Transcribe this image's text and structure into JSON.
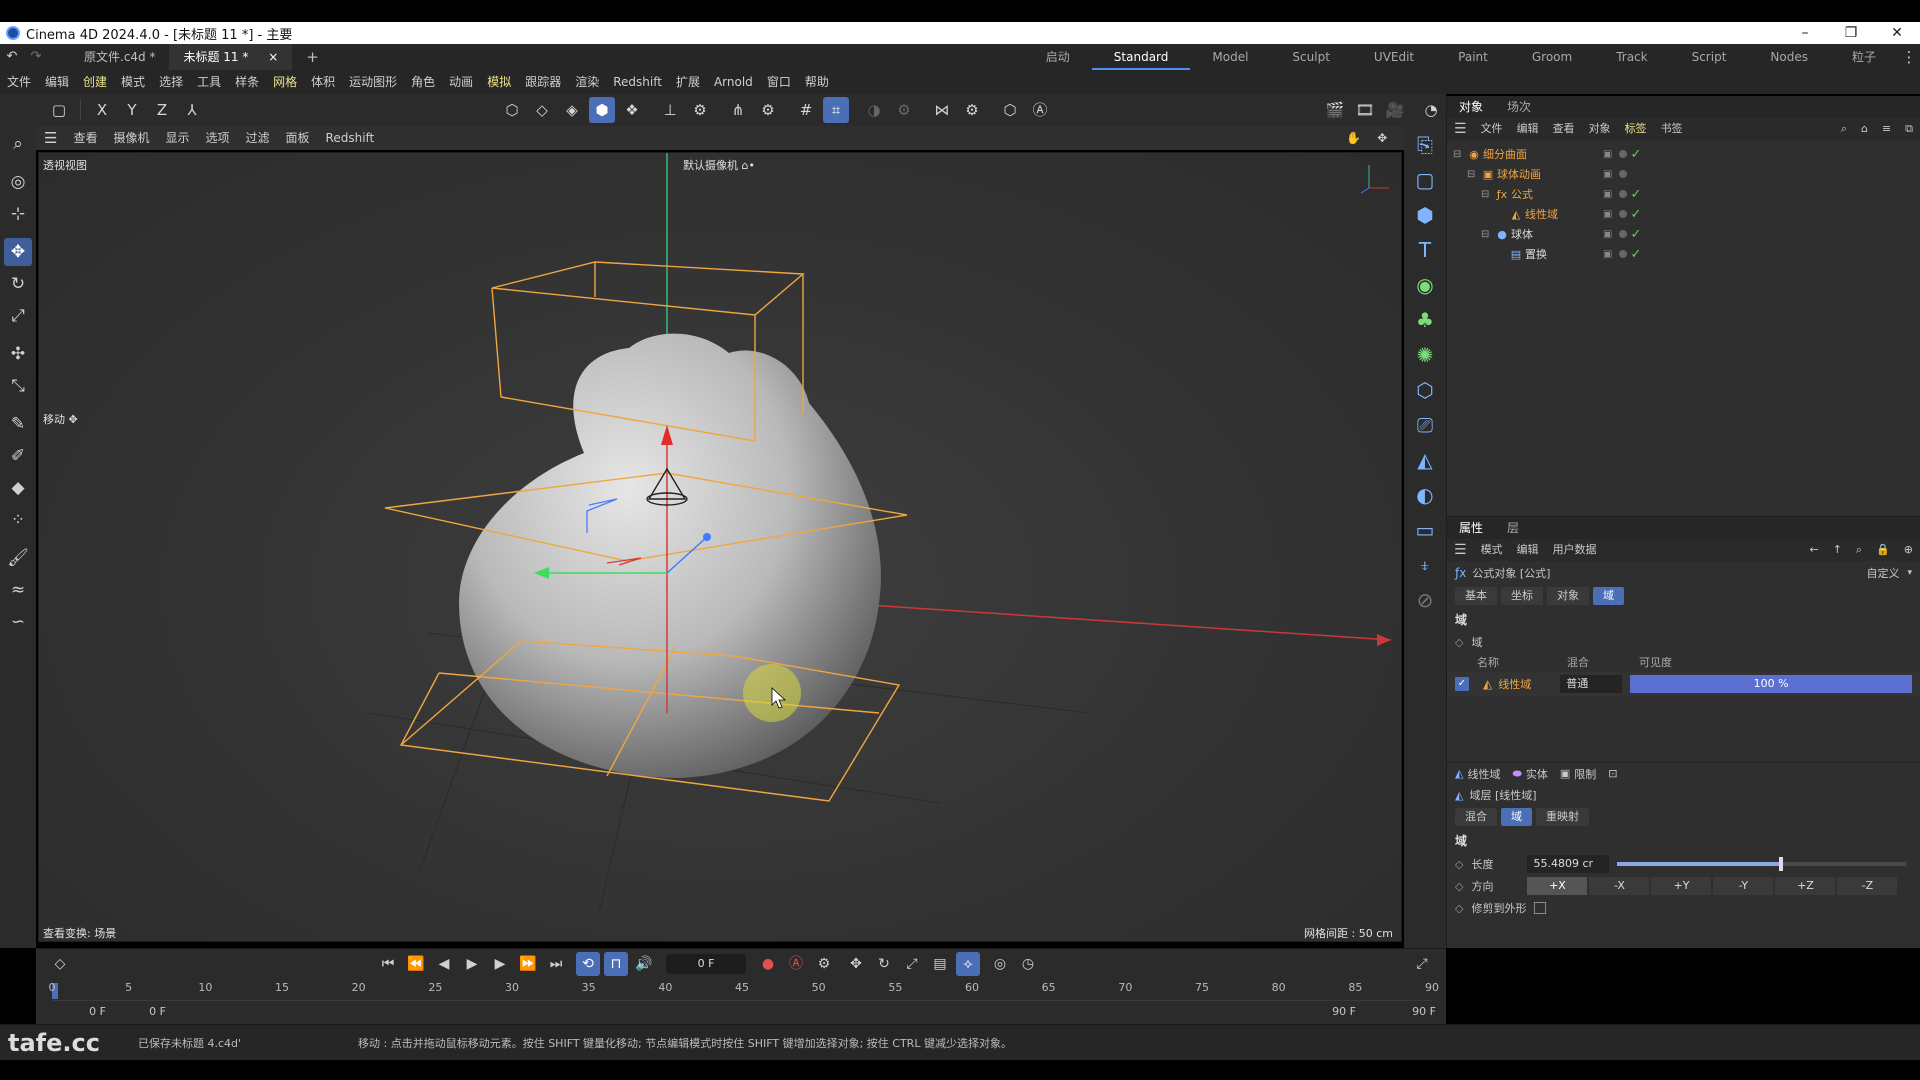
{
  "window": {
    "title": "Cinema 4D 2024.4.0 - [未标题 11 *] - 主要",
    "minimize": "–",
    "maximize": "❐",
    "close": "✕"
  },
  "doc_tabs": [
    {
      "label": "原文件.c4d *"
    },
    {
      "label": "未标题 11 *"
    }
  ],
  "doc_tab_close": "×",
  "doc_tab_add": "+",
  "layouts": [
    "启动",
    "Standard",
    "Model",
    "Sculpt",
    "UVEdit",
    "Paint",
    "Groom",
    "Track",
    "Script",
    "Nodes",
    "粒子"
  ],
  "menu": [
    "文件",
    "编辑",
    "创建",
    "模式",
    "选择",
    "工具",
    "样条",
    "网格",
    "体积",
    "运动图形",
    "角色",
    "动画",
    "模拟",
    "跟踪器",
    "渲染",
    "Redshift",
    "扩展",
    "Arnold",
    "窗口",
    "帮助"
  ],
  "toolbar_axes": [
    "X",
    "Y",
    "Z"
  ],
  "viewport_menu": [
    "查看",
    "摄像机",
    "显示",
    "选项",
    "过滤",
    "面板",
    "Redshift"
  ],
  "viewport": {
    "view_name": "透视视图",
    "camera": "默认摄像机 ⌂•",
    "move_label": "移动 ✥",
    "view_transform": "查看变换: 场景",
    "grid_spacing": "网格间距 : 50 cm"
  },
  "object_manager": {
    "tabs": [
      "对象",
      "场次"
    ],
    "menu": [
      "文件",
      "编辑",
      "查看",
      "对象",
      "标签",
      "书签"
    ],
    "tree": [
      {
        "name": "细分曲面",
        "indent": 0,
        "icon": "◉",
        "color": "#f0a640"
      },
      {
        "name": "球体动画",
        "indent": 1,
        "icon": "▣",
        "color": "#f0a640"
      },
      {
        "name": "公式",
        "indent": 2,
        "icon": "ƒx",
        "color": "#f0a640"
      },
      {
        "name": "线性域",
        "indent": 3,
        "icon": "◭",
        "color": "#f0a640"
      },
      {
        "name": "球体",
        "indent": 2,
        "icon": "●",
        "color": "#d8d8d8"
      },
      {
        "name": "置换",
        "indent": 3,
        "icon": "▤",
        "color": "#d8d8d8"
      }
    ]
  },
  "attributes": {
    "tabs": [
      "属性",
      "层"
    ],
    "menu": [
      "模式",
      "编辑",
      "用户数据"
    ],
    "object_title": "公式对象 [公式]",
    "preset": "自定义",
    "tabs2": [
      "基本",
      "坐标",
      "对象",
      "域"
    ],
    "section": "域",
    "subsection": "域",
    "table_headers": [
      "名称",
      "混合",
      "可见度"
    ],
    "field_row": {
      "name": "线性域",
      "blend": "普通",
      "visibility": "100 %",
      "visibility_fraction": 1.0
    },
    "layer_buttons": [
      "线性域",
      "实体",
      "限制"
    ],
    "layer_title": "域层 [线性域]",
    "layer_tabs": [
      "混合",
      "域",
      "重映射"
    ],
    "section2": "域",
    "length_label": "长度",
    "length_value": "55.4809 cr",
    "length_fraction": 0.56,
    "direction_label": "方向",
    "directions": [
      "+X",
      "-X",
      "+Y",
      "-Y",
      "+Z",
      "-Z"
    ],
    "clip_label": "修剪到外形"
  },
  "timeline": {
    "current_frame": "0 F",
    "ruler": [
      "0",
      "5",
      "10",
      "15",
      "20",
      "25",
      "30",
      "35",
      "40",
      "45",
      "50",
      "55",
      "60",
      "65",
      "70",
      "75",
      "80",
      "85",
      "90"
    ],
    "start": "0 F",
    "start2": "0 F",
    "end": "90 F",
    "end2": "90 F"
  },
  "status": {
    "file": "已保存未标题 4.c4d'",
    "hint": "移动 : 点击并拖动鼠标移动元素。按住 SHIFT 键量化移动; 节点编辑模式时按住 SHIFT 键增加选择对象; 按住 CTRL 键减少选择对象。",
    "watermark": "tafe.cc"
  },
  "colors": {
    "accent": "#4a6fb7",
    "selection_orange": "#f0a640",
    "check_green": "#5fd05f"
  }
}
